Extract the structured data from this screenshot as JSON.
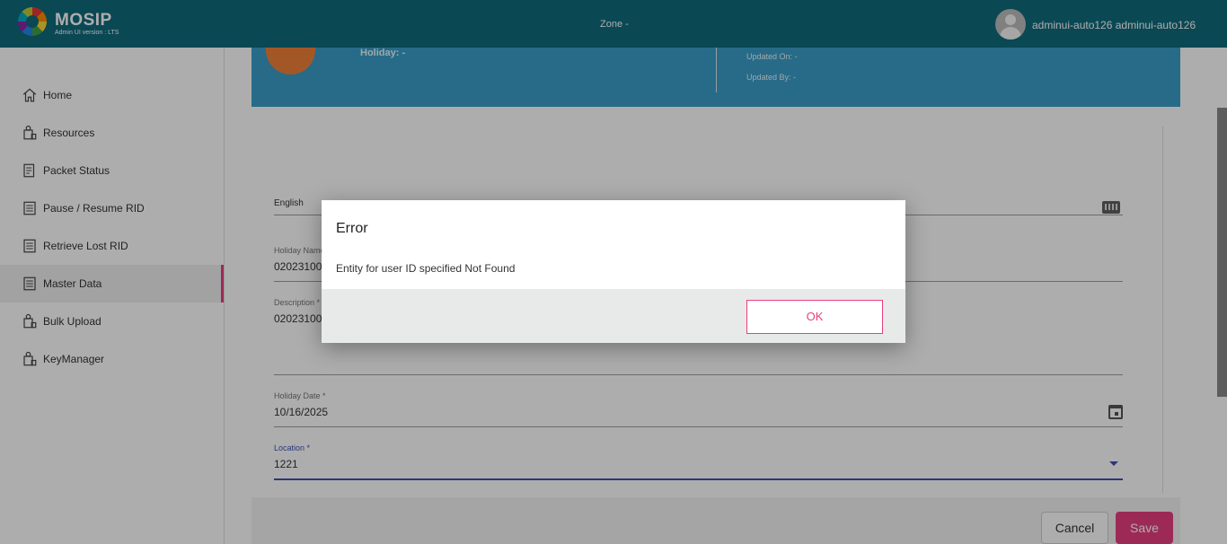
{
  "header": {
    "brand": "MOSIP",
    "version": "Admin UI version : LTS",
    "zone": "Zone -",
    "username": "adminui-auto126 adminui-auto126"
  },
  "sidebar": {
    "items": [
      {
        "label": "Home",
        "icon": "home-icon"
      },
      {
        "label": "Resources",
        "icon": "resources-icon"
      },
      {
        "label": "Packet Status",
        "icon": "packet-status-icon"
      },
      {
        "label": "Pause / Resume RID",
        "icon": "list-icon"
      },
      {
        "label": "Retrieve Lost RID",
        "icon": "list-icon"
      },
      {
        "label": "Master Data",
        "icon": "list-icon",
        "active": true
      },
      {
        "label": "Bulk Upload",
        "icon": "upload-icon"
      },
      {
        "label": "KeyManager",
        "icon": "key-manager-icon"
      }
    ]
  },
  "banner": {
    "holiday": "Holiday: -",
    "updated_on": "Updated On: -",
    "updated_by": "Updated By: -"
  },
  "form": {
    "language": "English",
    "holiday_name_label": "Holiday Name",
    "holiday_name_value": "02023100",
    "description_label": "Description *",
    "description_value": "02023100",
    "holiday_date_label": "Holiday Date *",
    "holiday_date_value": "10/16/2025",
    "location_label": "Location *",
    "location_value": "1221"
  },
  "footer": {
    "cancel": "Cancel",
    "save": "Save"
  },
  "dialog": {
    "title": "Error",
    "message": "Entity for user ID specified Not Found",
    "ok": "OK"
  },
  "colors": {
    "header": "#0f6b7c",
    "banner": "#3a9ec9",
    "accent": "#e83f7f"
  }
}
